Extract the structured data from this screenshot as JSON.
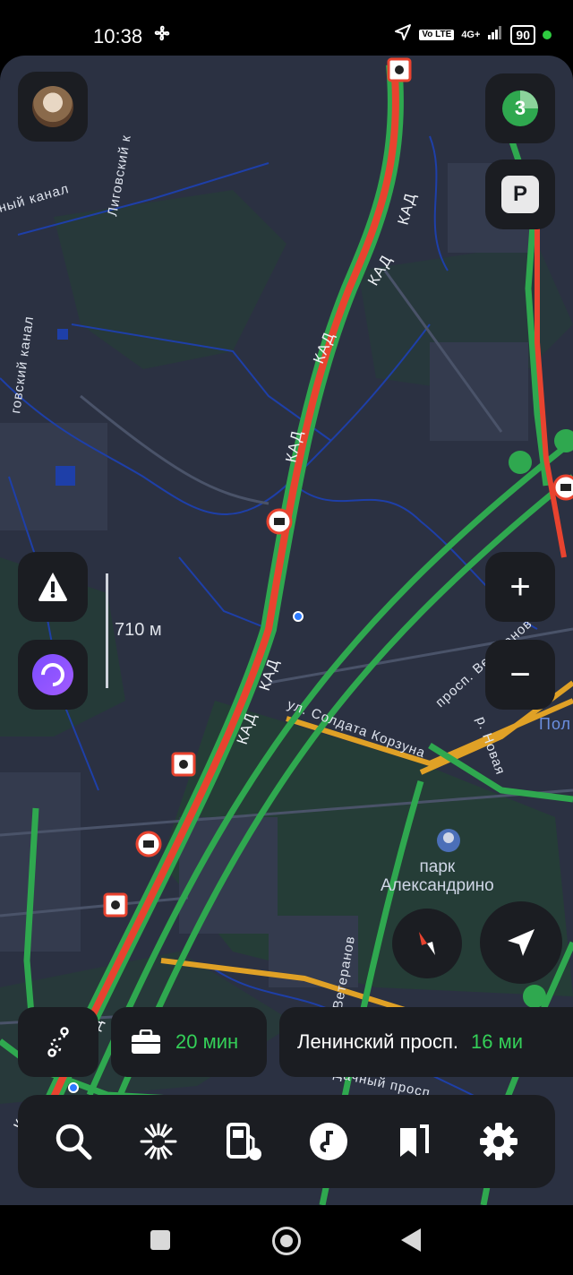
{
  "status_bar": {
    "time": "10:38",
    "network": "4G+",
    "volte": "Vo LTE",
    "battery": "90"
  },
  "map": {
    "road_labels": {
      "kad": "КАД",
      "soldata_korzuna": "ул. Солдата Корзуна",
      "prosp_veteranov": "просп. Ветеранов",
      "prosp_veteranov_lower": "просп. Ветеранов",
      "novaya": "р. Новая",
      "dachny": "Дачный просп.",
      "ligovsky_1": "Лиговский к",
      "ligovsky_2": "ный канал",
      "ligovsky_3": "говский канал",
      "pol": "Пол"
    },
    "park": {
      "line1": "парк",
      "line2": "Александрино"
    },
    "scale_label": "710 м",
    "colors": {
      "background": "#2b3142",
      "traffic_red": "#e8432f",
      "traffic_green": "#2fa84f",
      "traffic_yellow": "#e0a126",
      "water": "#1e3fa8",
      "greenery": "#243f35"
    }
  },
  "controls": {
    "avatar": "avatar",
    "traffic_score": "3",
    "parking_label": "P",
    "zoom_in": "+",
    "zoom_out": "−"
  },
  "bottom_bar": {
    "route_icon": "route-icon",
    "work_time": "20 мин",
    "destination": "Ленинский просп.",
    "destination_time": "16 ми"
  },
  "menu_icons": [
    "search-icon",
    "bulb-icon",
    "fuel-icon",
    "music-icon",
    "bookmarks-icon",
    "settings-icon"
  ]
}
